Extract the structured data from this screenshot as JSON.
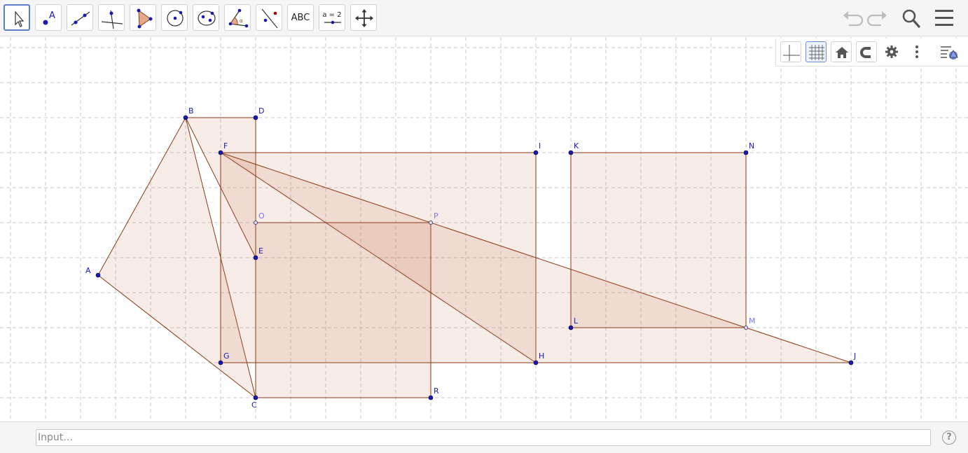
{
  "toolbar": {
    "tools": [
      {
        "id": "move",
        "icon": "move-cursor-icon",
        "selected": true
      },
      {
        "id": "point",
        "icon": "point-icon",
        "label": "A"
      },
      {
        "id": "line",
        "icon": "line-through-two-points-icon"
      },
      {
        "id": "perpendicular",
        "icon": "perpendicular-line-icon"
      },
      {
        "id": "polygon",
        "icon": "polygon-icon"
      },
      {
        "id": "circle",
        "icon": "circle-center-point-icon"
      },
      {
        "id": "conic",
        "icon": "ellipse-icon"
      },
      {
        "id": "angle",
        "icon": "angle-icon",
        "label": "α"
      },
      {
        "id": "reflect",
        "icon": "reflect-about-line-icon"
      },
      {
        "id": "text",
        "icon": "text-icon",
        "label": "ABC"
      },
      {
        "id": "slider",
        "icon": "slider-icon",
        "label": "a = 2"
      },
      {
        "id": "move-graphics",
        "icon": "move-graphics-view-icon"
      }
    ],
    "right_buttons": [
      "undo-icon",
      "redo-icon",
      "search-icon",
      "menu-icon"
    ]
  },
  "graphics_bar": {
    "buttons": [
      "axes-icon",
      "grid-icon",
      "home-icon",
      "magnet-icon",
      "gear-icon",
      "more-vertical-icon",
      "style-bar-icon"
    ],
    "grid_active": true
  },
  "construction": {
    "points": [
      {
        "name": "A",
        "x": -1.5,
        "y": 2.5
      },
      {
        "name": "B",
        "x": 1,
        "y": 7
      },
      {
        "name": "C",
        "x": 3,
        "y": -1
      },
      {
        "name": "D",
        "x": 3,
        "y": 7
      },
      {
        "name": "E",
        "x": 3,
        "y": 3
      },
      {
        "name": "F",
        "x": 2,
        "y": 6
      },
      {
        "name": "G",
        "x": 2,
        "y": 0
      },
      {
        "name": "H",
        "x": 11,
        "y": 0
      },
      {
        "name": "I",
        "x": 11,
        "y": 6
      },
      {
        "name": "J",
        "x": 20,
        "y": 0
      },
      {
        "name": "K",
        "x": 12,
        "y": 6
      },
      {
        "name": "L",
        "x": 12,
        "y": 1
      },
      {
        "name": "M",
        "x": 17,
        "y": 1,
        "dependent": true
      },
      {
        "name": "N",
        "x": 17,
        "y": 6
      },
      {
        "name": "O",
        "x": 3,
        "y": 4,
        "dependent": true
      },
      {
        "name": "P",
        "x": 8,
        "y": 4,
        "dependent": true
      },
      {
        "name": "R",
        "x": 8,
        "y": -1
      }
    ],
    "polygons": [
      [
        "A",
        "B",
        "C"
      ],
      [
        "B",
        "D",
        "E"
      ],
      [
        "F",
        "G",
        "H",
        "I"
      ],
      [
        "F",
        "H",
        "J"
      ],
      [
        "K",
        "L",
        "M",
        "N"
      ],
      [
        "O",
        "P",
        "R",
        "C"
      ]
    ],
    "fill_color": "#c56a44",
    "stroke_color": "#8b3a14",
    "point_color": "#1a1ab3",
    "dependent_point_color": "#8080e0"
  },
  "input": {
    "placeholder": "Input…",
    "help_label": "?"
  }
}
